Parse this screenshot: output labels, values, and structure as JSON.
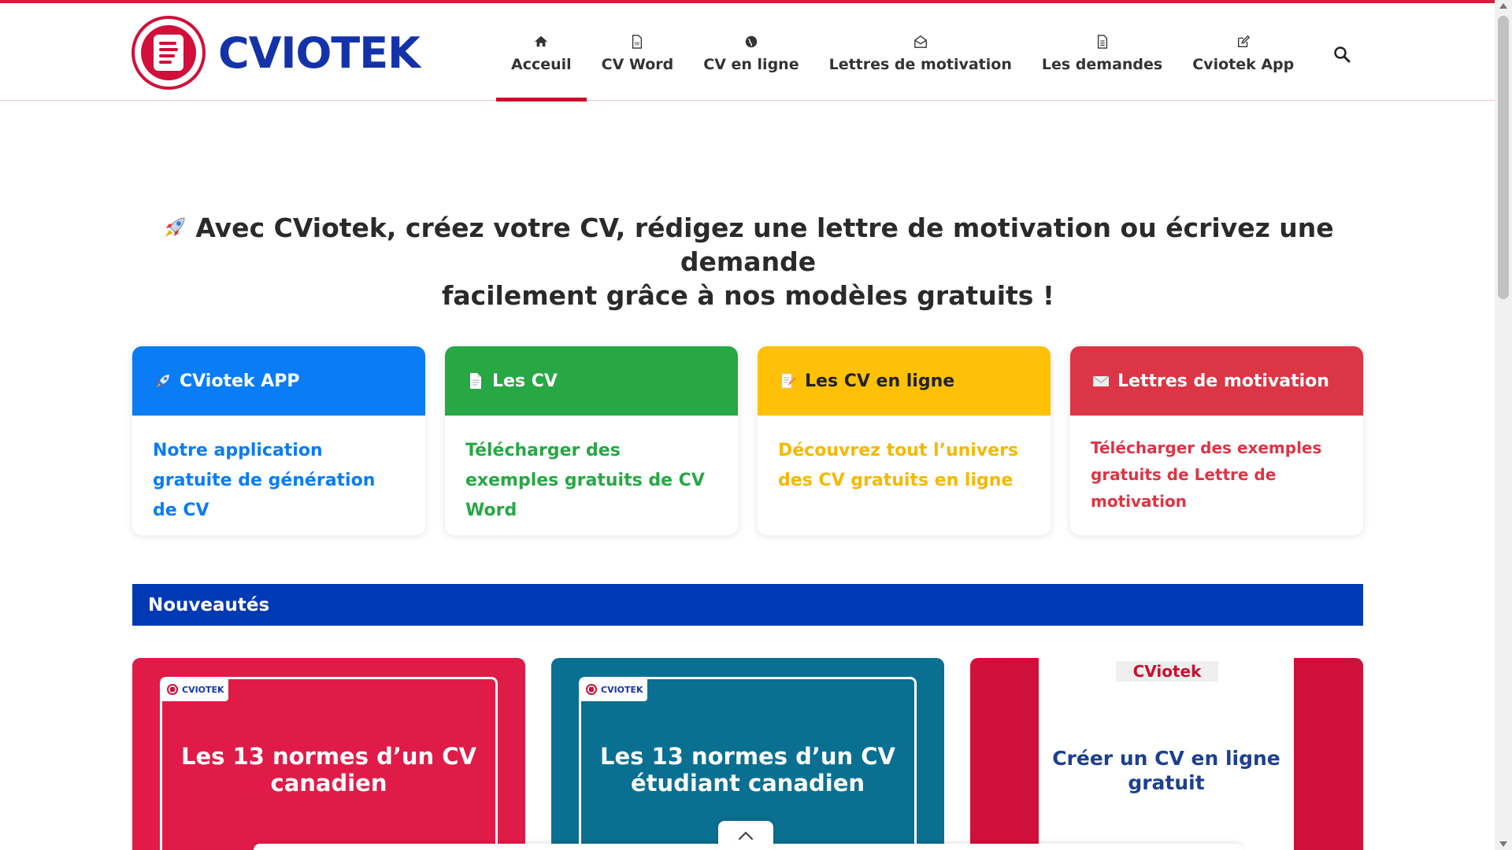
{
  "brand": {
    "name": "CVIOTEK",
    "accent": "#c8102e",
    "blue": "#1533a8"
  },
  "nav": [
    {
      "label": "Acceuil",
      "icon": "home-icon",
      "active": true
    },
    {
      "label": "CV Word",
      "icon": "word-file-icon",
      "active": false
    },
    {
      "label": "CV en ligne",
      "icon": "globe-icon",
      "active": false
    },
    {
      "label": "Lettres de motivation",
      "icon": "envelope-open-icon",
      "active": false
    },
    {
      "label": "Les demandes",
      "icon": "document-icon",
      "active": false
    },
    {
      "label": "Cviotek App",
      "icon": "edit-icon",
      "active": false
    }
  ],
  "hero": {
    "line1": "Avec CViotek, créez votre CV, rédigez une lettre de motivation ou écrivez une demande",
    "line2": "facilement grâce à nos modèles gratuits !"
  },
  "cards": [
    {
      "title": "CViotek APP",
      "icon": "rocket-icon",
      "color": "#0a7cf5",
      "text": "Notre application gratuite de génération de CV"
    },
    {
      "title": "Les CV",
      "icon": "page-icon",
      "color": "#28a745",
      "text": "Télécharger des exemples gratuits de CV Word"
    },
    {
      "title": "Les CV en ligne",
      "icon": "memo-icon",
      "color": "#ffc107",
      "text_color": "#f5b800",
      "text": "Découvrez tout l’univers des CV gratuits en ligne"
    },
    {
      "title": "Lettres de motivation",
      "icon": "envelope-icon",
      "color": "#dc3545",
      "text": "Télécharger des exemples gratuits de Lettre de motivation"
    }
  ],
  "news": {
    "heading": "Nouveautés",
    "posts": [
      {
        "badge": "CVIOTEK",
        "title": "Les 13 normes d’un CV canadien",
        "color": "#e01b48"
      },
      {
        "badge": "CVIOTEK",
        "title": "Les 13 normes d’un CV étudiant canadien",
        "color": "#0a7091"
      },
      {
        "tag": "CViotek",
        "title": "Créer un CV en ligne gratuit"
      }
    ]
  }
}
